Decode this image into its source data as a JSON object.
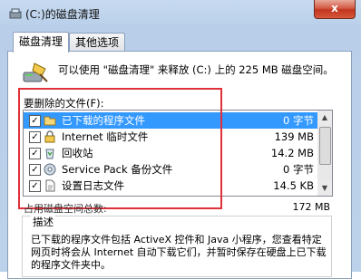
{
  "window": {
    "title": "(C:)的磁盘清理",
    "close_label": "x"
  },
  "tabs": [
    {
      "label": "磁盘清理",
      "active": true
    },
    {
      "label": "其他选项",
      "active": false
    }
  ],
  "intro": {
    "text": "可以使用 \"磁盘清理\" 来释放 (C:) 上的 225 MB 磁盘空间。"
  },
  "files_to_delete": {
    "label": "要删除的文件(F):",
    "items": [
      {
        "name": "已下载的程序文件",
        "size": "0 字节",
        "checked": true,
        "selected": true,
        "icon": "folder-icon"
      },
      {
        "name": "Internet 临时文件",
        "size": "139 MB",
        "checked": true,
        "selected": false,
        "icon": "lock-icon"
      },
      {
        "name": "回收站",
        "size": "14.2 MB",
        "checked": true,
        "selected": false,
        "icon": "recycle-bin-icon"
      },
      {
        "name": "Service Pack 备份文件",
        "size": "0 字节",
        "checked": true,
        "selected": false,
        "icon": "disc-icon"
      },
      {
        "name": "设置日志文件",
        "size": "14.5 KB",
        "checked": true,
        "selected": false,
        "icon": "document-icon"
      }
    ]
  },
  "total": {
    "label": "占用磁盘空间总数:",
    "value": "172 MB"
  },
  "description": {
    "title": "描述",
    "text": "已下载的程序文件包括 ActiveX 控件和 Java 小程序，您查看特定网页时将会从 Internet 自动下载它们，并暂时保存在硬盘上已下载的程序文件夹中。"
  },
  "colors": {
    "selection": "#3399ff",
    "highlight_border": "#e0303a",
    "close_button": "#c2351f"
  }
}
